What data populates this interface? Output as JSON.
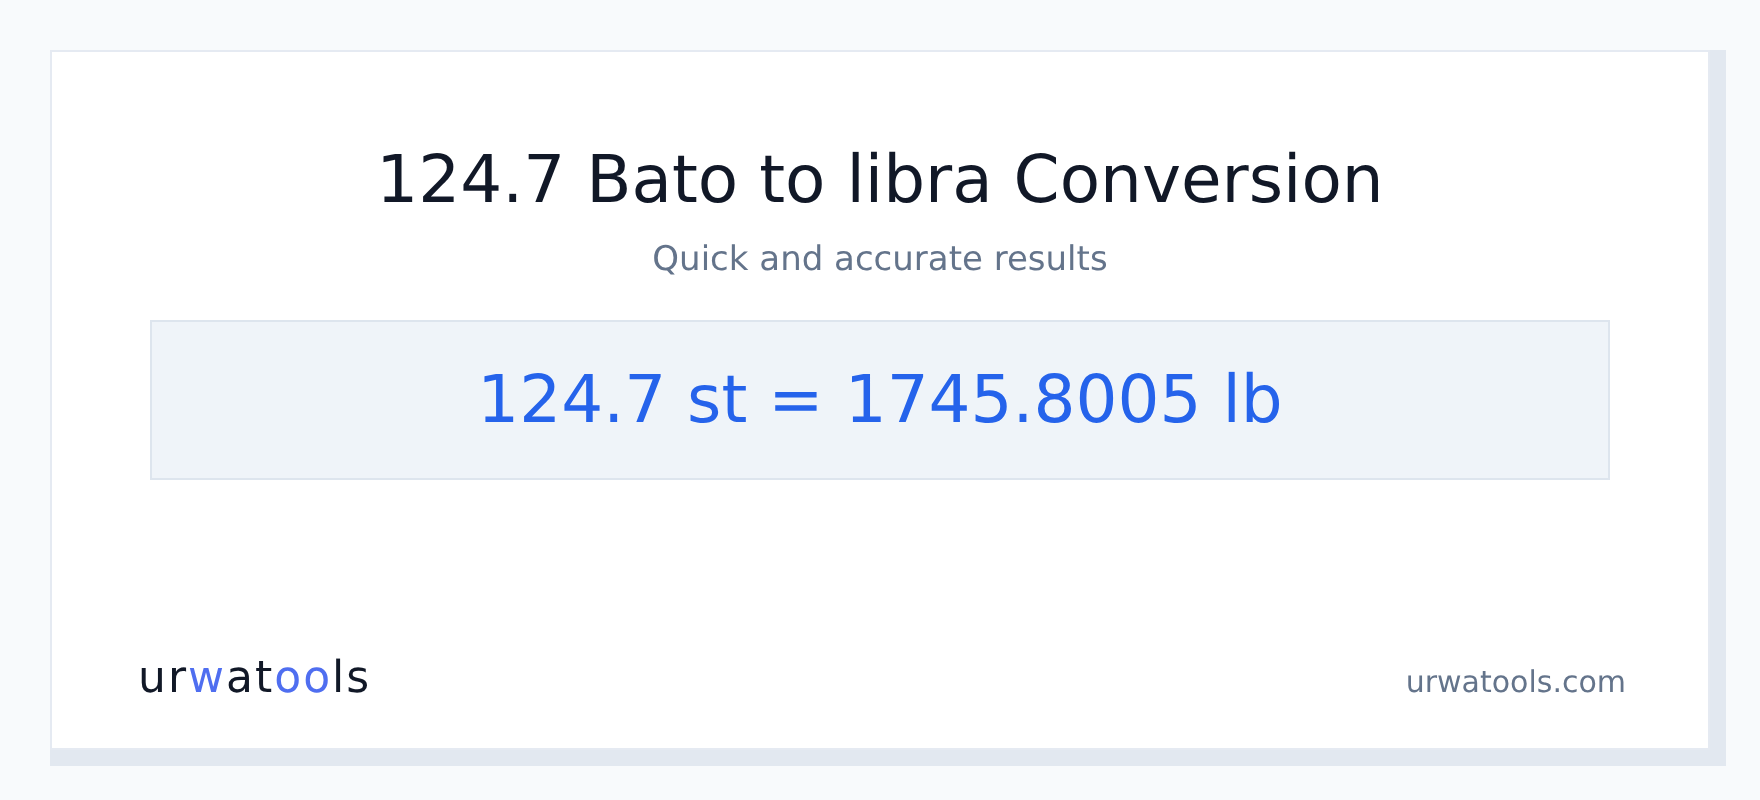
{
  "title": "124.7 Bato to libra Conversion",
  "subtitle": "Quick and accurate results",
  "result": "124.7 st = 1745.8005 lb",
  "logo": [
    {
      "text": "ur",
      "accent": false
    },
    {
      "text": "w",
      "accent": true
    },
    {
      "text": "at",
      "accent": false
    },
    {
      "text": "oo",
      "accent": true
    },
    {
      "text": "ls",
      "accent": false
    }
  ],
  "site": "urwatools.com"
}
